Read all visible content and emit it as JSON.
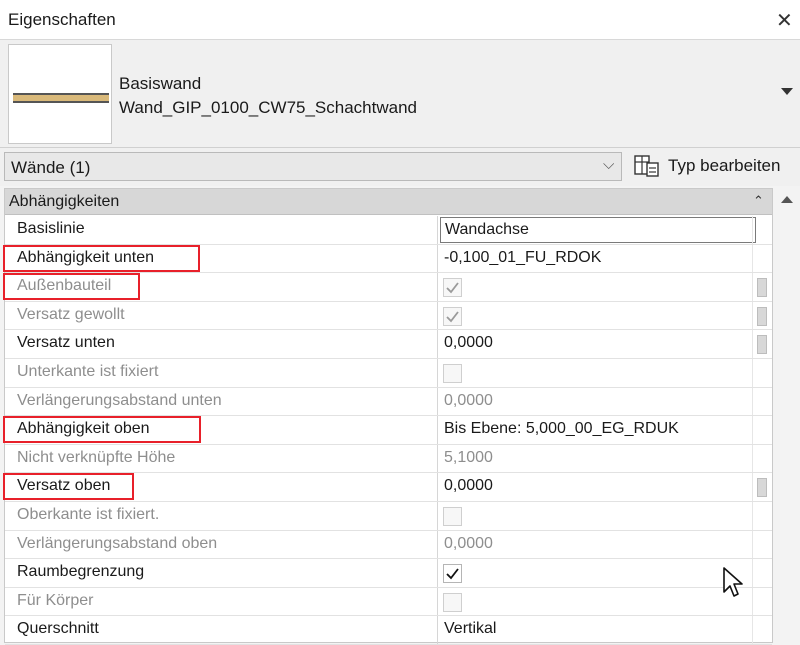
{
  "window": {
    "title": "Eigenschaften"
  },
  "type_selector": {
    "family": "Basiswand",
    "type": "Wand_GIP_0100_CW75_Schachtwand"
  },
  "filter": {
    "selected": "Wände (1)",
    "edit_type_label": "Typ bearbeiten"
  },
  "section": {
    "label": "Abhängigkeiten"
  },
  "rows": [
    {
      "name": "Basislinie",
      "value": "Wandachse",
      "kind": "dropdown",
      "enabled": true,
      "highlighted": false
    },
    {
      "name": "Abhängigkeit unten",
      "value": "-0,100_01_FU_RDOK",
      "kind": "text",
      "enabled": true,
      "highlighted": true
    },
    {
      "name": "Außenbauteil",
      "value": "",
      "kind": "checkbox",
      "checked": true,
      "enabled": false,
      "highlighted": true
    },
    {
      "name": "Versatz gewollt",
      "value": "",
      "kind": "checkbox",
      "checked": true,
      "enabled": false,
      "highlighted": false
    },
    {
      "name": "Versatz unten",
      "value": "0,0000",
      "kind": "text",
      "enabled": true,
      "highlighted": false
    },
    {
      "name": "Unterkante ist fixiert",
      "value": "",
      "kind": "checkbox",
      "checked": false,
      "enabled": false,
      "highlighted": false
    },
    {
      "name": "Verlängerungsabstand unten",
      "value": "0,0000",
      "kind": "text",
      "enabled": false,
      "highlighted": false
    },
    {
      "name": "Abhängigkeit oben",
      "value": "Bis Ebene: 5,000_00_EG_RDUK",
      "kind": "text",
      "enabled": true,
      "highlighted": true
    },
    {
      "name": "Nicht verknüpfte Höhe",
      "value": "5,1000",
      "kind": "text",
      "enabled": false,
      "highlighted": false
    },
    {
      "name": "Versatz oben",
      "value": "0,0000",
      "kind": "text",
      "enabled": true,
      "highlighted": true
    },
    {
      "name": "Oberkante ist fixiert.",
      "value": "",
      "kind": "checkbox",
      "checked": false,
      "enabled": false,
      "highlighted": false
    },
    {
      "name": "Verlängerungsabstand oben",
      "value": "0,0000",
      "kind": "text",
      "enabled": false,
      "highlighted": false
    },
    {
      "name": "Raumbegrenzung",
      "value": "",
      "kind": "checkbox",
      "checked": true,
      "enabled": true,
      "highlighted": false
    },
    {
      "name": "Für Körper",
      "value": "",
      "kind": "checkbox",
      "checked": false,
      "enabled": false,
      "highlighted": false
    },
    {
      "name": "Querschnitt",
      "value": "Vertikal",
      "kind": "text",
      "enabled": true,
      "highlighted": false
    }
  ],
  "colors": {
    "highlight": "#e8202a",
    "disabled_text": "#8e8e8e",
    "section_header": "#d7d7d7",
    "wall_fill": "#d9b97a"
  }
}
